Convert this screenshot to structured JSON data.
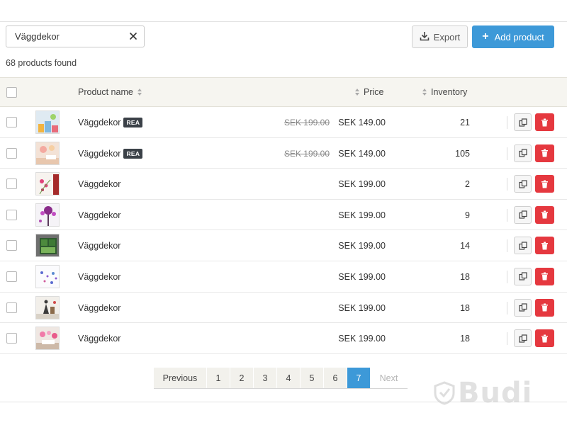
{
  "search": {
    "value": "Väggdekor",
    "placeholder": ""
  },
  "toolbar": {
    "export_label": "Export",
    "add_label": "Add product"
  },
  "results": {
    "found_text": "68 products found"
  },
  "table": {
    "headers": {
      "name": "Product name",
      "price": "Price",
      "inventory": "Inventory"
    },
    "rows": [
      {
        "name": "Väggdekor",
        "badge": "REA",
        "old_price": "SEK 199.00",
        "price": "SEK 149.00",
        "inventory": "21",
        "thumb": "room-colorful"
      },
      {
        "name": "Väggdekor",
        "badge": "REA",
        "old_price": "SEK 199.00",
        "price": "SEK 149.00",
        "inventory": "105",
        "thumb": "room-peach"
      },
      {
        "name": "Väggdekor",
        "badge": "",
        "old_price": "",
        "price": "SEK 199.00",
        "inventory": "2",
        "thumb": "flowers-red"
      },
      {
        "name": "Väggdekor",
        "badge": "",
        "old_price": "",
        "price": "SEK 199.00",
        "inventory": "9",
        "thumb": "tree-purple"
      },
      {
        "name": "Väggdekor",
        "badge": "",
        "old_price": "",
        "price": "SEK 199.00",
        "inventory": "14",
        "thumb": "window-green"
      },
      {
        "name": "Väggdekor",
        "badge": "",
        "old_price": "",
        "price": "SEK 199.00",
        "inventory": "18",
        "thumb": "dots-blue"
      },
      {
        "name": "Väggdekor",
        "badge": "",
        "old_price": "",
        "price": "SEK 199.00",
        "inventory": "18",
        "thumb": "wall-figures"
      },
      {
        "name": "Väggdekor",
        "badge": "",
        "old_price": "",
        "price": "SEK 199.00",
        "inventory": "18",
        "thumb": "room-pink"
      }
    ]
  },
  "pagination": {
    "prev_label": "Previous",
    "pages": [
      "1",
      "2",
      "3",
      "4",
      "5",
      "6",
      "7"
    ],
    "current": "7",
    "next_label": "Next"
  },
  "watermark": {
    "text": "Budi"
  },
  "colors": {
    "primary": "#3d99d8",
    "danger": "#e5383f",
    "badge": "#3b4148",
    "header_bg": "#f6f5f0"
  }
}
